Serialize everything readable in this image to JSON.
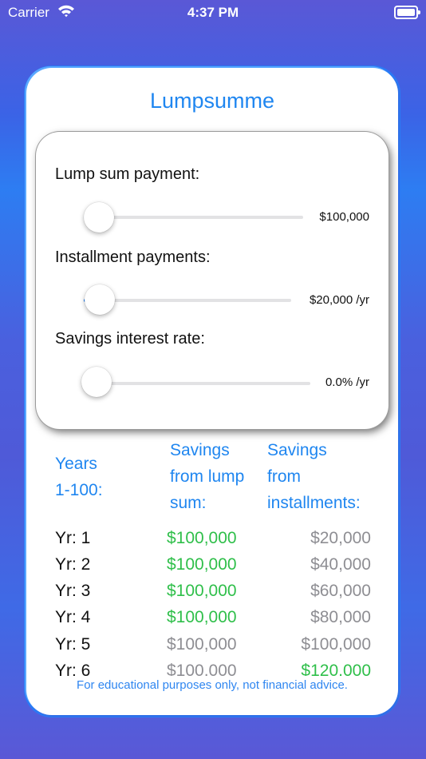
{
  "status_bar": {
    "carrier": "Carrier",
    "time": "4:37 PM"
  },
  "app": {
    "title": "Lumpsumme"
  },
  "inputs": {
    "lump_sum": {
      "label": "Lump sum payment:",
      "value": "$100,000",
      "slider_fraction": 0.0
    },
    "installments": {
      "label": "Installment payments:",
      "value": "$20,000 /yr",
      "slider_fraction": 0.0
    },
    "interest": {
      "label": "Savings interest rate:",
      "value": "0.0% /yr",
      "slider_fraction": 0.0
    }
  },
  "table": {
    "col_years": [
      "Years",
      "1-100:"
    ],
    "col_lump": [
      "Savings",
      "from lump",
      "sum:"
    ],
    "col_inst": [
      "Savings",
      "from",
      "installments:"
    ],
    "rows": [
      {
        "yr": "Yr:  1",
        "lump": "$100,000",
        "inst": "$20,000",
        "winner": "lump"
      },
      {
        "yr": "Yr:  2",
        "lump": "$100,000",
        "inst": "$40,000",
        "winner": "lump"
      },
      {
        "yr": "Yr:  3",
        "lump": "$100,000",
        "inst": "$60,000",
        "winner": "lump"
      },
      {
        "yr": "Yr:  4",
        "lump": "$100,000",
        "inst": "$80,000",
        "winner": "lump"
      },
      {
        "yr": "Yr:  5",
        "lump": "$100,000",
        "inst": "$100,000",
        "winner": "none"
      },
      {
        "yr": "Yr:  6",
        "lump": "$100,000",
        "inst": "$120,000",
        "winner": "inst"
      }
    ]
  },
  "footer": "For educational purposes only, not financial advice.",
  "colors": {
    "accent": "#1f86f0",
    "win": "#2fbf4a",
    "neutral": "#8e8e93"
  }
}
